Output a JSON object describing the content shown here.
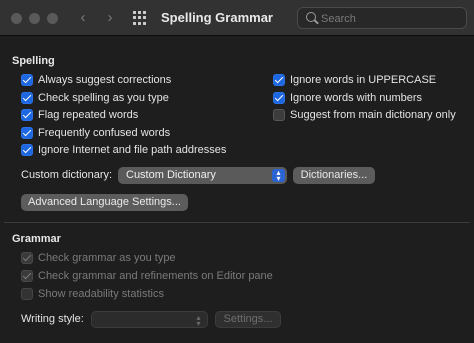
{
  "window": {
    "title": "Spelling  Grammar",
    "search_placeholder": "Search"
  },
  "spelling": {
    "heading": "Spelling",
    "left_options": [
      {
        "label": "Always suggest corrections",
        "checked": true
      },
      {
        "label": "Check spelling as you type",
        "checked": true
      },
      {
        "label": "Flag repeated words",
        "checked": true
      },
      {
        "label": "Frequently confused words",
        "checked": true
      },
      {
        "label": "Ignore Internet and file path addresses",
        "checked": true
      }
    ],
    "right_options": [
      {
        "label": "Ignore words in UPPERCASE",
        "checked": true
      },
      {
        "label": "Ignore words with numbers",
        "checked": true
      },
      {
        "label": "Suggest from main dictionary only",
        "checked": false
      }
    ],
    "custom_dictionary_label": "Custom dictionary:",
    "custom_dictionary_value": "Custom Dictionary",
    "dictionaries_button": "Dictionaries...",
    "advanced_button": "Advanced Language Settings..."
  },
  "grammar": {
    "heading": "Grammar",
    "options": [
      {
        "label": "Check grammar as you type",
        "checked": true,
        "disabled": true
      },
      {
        "label": "Check grammar and refinements on Editor pane",
        "checked": true,
        "disabled": true
      },
      {
        "label": "Show readability statistics",
        "checked": false,
        "disabled": true
      }
    ],
    "writing_style_label": "Writing style:",
    "writing_style_value": "",
    "settings_button": "Settings..."
  },
  "colors": {
    "accent": "#1d67e0",
    "background": "#1e1e1e",
    "titlebar": "#323232"
  }
}
